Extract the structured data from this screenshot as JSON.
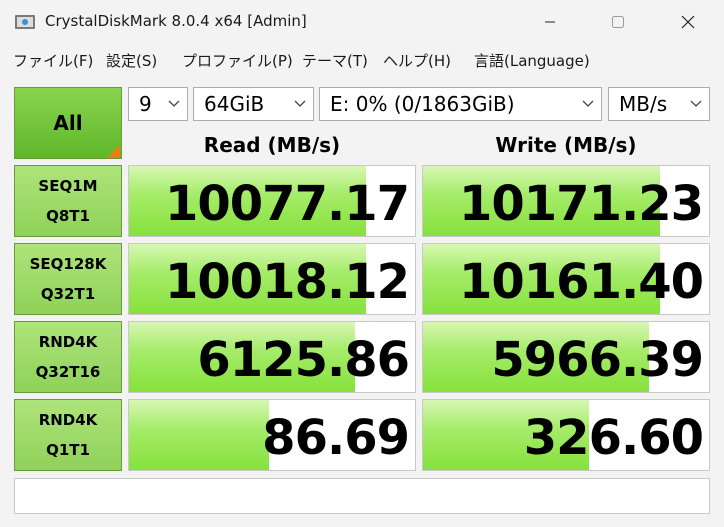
{
  "window": {
    "title": "CrystalDiskMark 8.0.4 x64 [Admin]"
  },
  "menu": [
    {
      "label": "ファイル(F)"
    },
    {
      "label": "設定(S)"
    },
    {
      "label": "プロファイル(P)"
    },
    {
      "label": "テーマ(T)"
    },
    {
      "label": "ヘルプ(H)"
    },
    {
      "label": "言語(Language)"
    }
  ],
  "controls": {
    "all_label": "All",
    "count": "9",
    "size": "64GiB",
    "drive": "E: 0% (0/1863GiB)",
    "unit": "MB/s"
  },
  "headers": {
    "read": "Read (MB/s)",
    "write": "Write (MB/s)"
  },
  "rows": [
    {
      "label1": "SEQ1M",
      "label2": "Q8T1",
      "read": "10077.17",
      "write": "10171.23",
      "read_fill": 0.83,
      "write_fill": 0.83
    },
    {
      "label1": "SEQ128K",
      "label2": "Q32T1",
      "read": "10018.12",
      "write": "10161.40",
      "read_fill": 0.83,
      "write_fill": 0.83
    },
    {
      "label1": "RND4K",
      "label2": "Q32T16",
      "read": "6125.86",
      "write": "5966.39",
      "read_fill": 0.79,
      "write_fill": 0.79
    },
    {
      "label1": "RND4K",
      "label2": "Q1T1",
      "read": "86.69",
      "write": "326.60",
      "read_fill": 0.49,
      "write_fill": 0.58
    }
  ],
  "status_text": "",
  "colors": {
    "accent_green": "#86e13c",
    "corner_orange": "#f07b14"
  },
  "icons": {
    "app": "crystaldiskmark-icon",
    "minimize": "minimize-icon",
    "maximize": "maximize-icon",
    "close": "close-icon",
    "dropdown": "chevron-down-icon"
  }
}
